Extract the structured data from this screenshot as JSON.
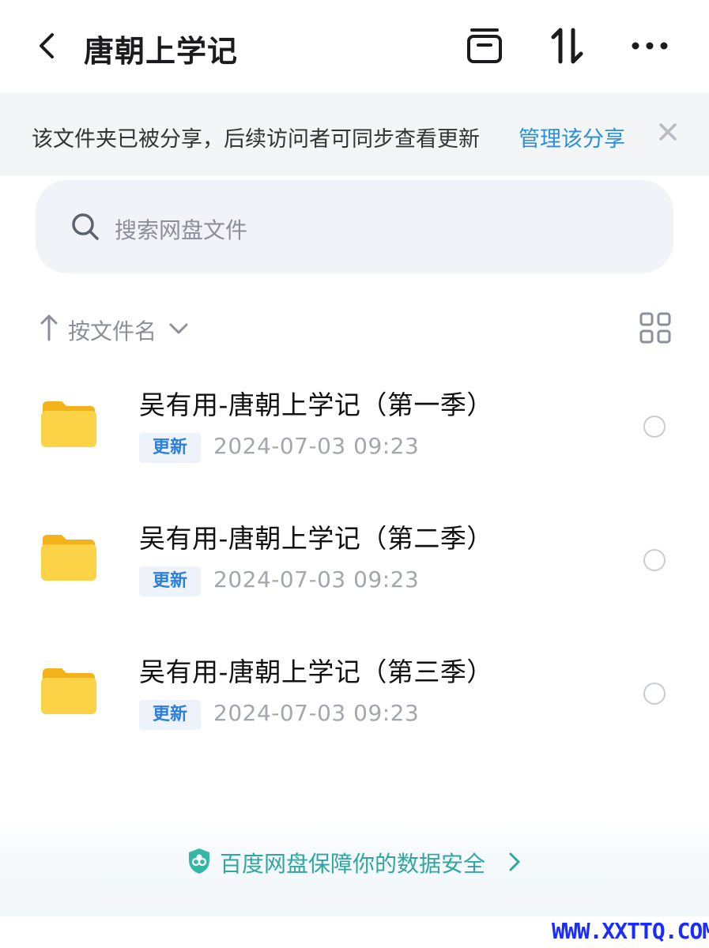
{
  "header": {
    "title": "唐朝上学记",
    "icons": [
      "back-icon",
      "archive-icon",
      "sort-arrows-icon",
      "more-icon"
    ]
  },
  "notice": {
    "text": "该文件夹已被分享，后续访问者可同步查看更新",
    "link": "管理该分享"
  },
  "search": {
    "placeholder": "搜索网盘文件"
  },
  "sort": {
    "label": "按文件名"
  },
  "files": [
    {
      "name": "吴有用-唐朝上学记（第一季）",
      "badge": "更新",
      "date": "2024-07-03  09:23"
    },
    {
      "name": "吴有用-唐朝上学记（第二季）",
      "badge": "更新",
      "date": "2024-07-03  09:23"
    },
    {
      "name": "吴有用-唐朝上学记（第三季）",
      "badge": "更新",
      "date": "2024-07-03  09:23"
    }
  ],
  "footer": {
    "text": "百度网盘保障你的数据安全"
  },
  "watermark": "WWW.XXTTQ.COM",
  "colors": {
    "accent": "#2b8fd6",
    "badge_text": "#2d7fd8",
    "footer_text": "#2fa6a0",
    "folder": "#f9c732",
    "watermark": "#1a2cff"
  }
}
